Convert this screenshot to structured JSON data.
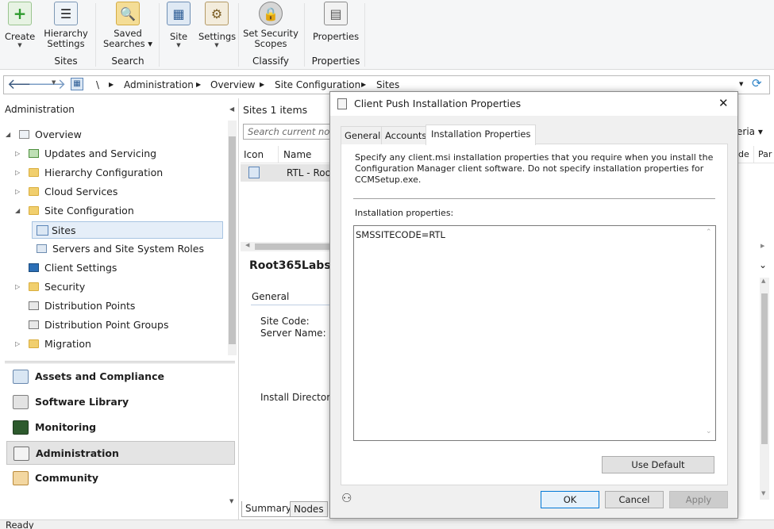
{
  "ribbon": {
    "buttons": [
      {
        "label": "Create",
        "has_arrow": true
      },
      {
        "label": "Hierarchy Settings",
        "has_arrow": false
      },
      {
        "label": "Saved Searches ▾",
        "has_arrow": false
      },
      {
        "label": "Site",
        "has_arrow": true
      },
      {
        "label": "Settings",
        "has_arrow": true
      },
      {
        "label": "Set Security Scopes",
        "has_arrow": false
      },
      {
        "label": "Properties",
        "has_arrow": false
      }
    ],
    "groups": {
      "sites": "Sites",
      "search": "Search",
      "classify": "Classify",
      "properties": "Properties"
    }
  },
  "address": {
    "root": "\\",
    "crumbs": [
      "Administration",
      "Overview",
      "Site Configuration",
      "Sites"
    ]
  },
  "nav": {
    "title": "Administration",
    "items": {
      "overview": "Overview",
      "updates": "Updates and Servicing",
      "hierarchy": "Hierarchy Configuration",
      "cloud": "Cloud Services",
      "siteconfig": "Site Configuration",
      "sites": "Sites",
      "servers": "Servers and Site System Roles",
      "clientsettings": "Client Settings",
      "security": "Security",
      "distpoints": "Distribution Points",
      "distgroups": "Distribution Point Groups",
      "migration": "Migration"
    },
    "workspaces": {
      "assets": "Assets and Compliance",
      "software": "Software Library",
      "monitoring": "Monitoring",
      "administration": "Administration",
      "community": "Community"
    }
  },
  "list": {
    "header": "Sites 1 items",
    "search_placeholder": "Search current node",
    "criteria": "eria ▾",
    "columns": {
      "icon": "Icon",
      "name": "Name",
      "de": "de",
      "par": "Par"
    },
    "row_name": "RTL - Root"
  },
  "details": {
    "title": "Root365Labs",
    "section": "General",
    "site_code_label": "Site Code:",
    "server_name_label": "Server Name:",
    "install_dir_label": "Install Directory:",
    "tabs": {
      "summary": "Summary",
      "nodes": "Nodes"
    }
  },
  "dialog": {
    "title": "Client Push Installation Properties",
    "close": "✕",
    "tabs": {
      "general": "General",
      "accounts": "Accounts",
      "installation": "Installation Properties"
    },
    "description": "Specify any client.msi installation properties that you require when you install the Configuration Manager client software. Do not specify installation properties for CCMSetup.exe.",
    "prop_label": "Installation properties:",
    "prop_value": "SMSSITECODE=RTL",
    "use_default": "Use Default",
    "ok": "OK",
    "cancel": "Cancel",
    "apply": "Apply"
  },
  "status": {
    "text": "Ready"
  }
}
